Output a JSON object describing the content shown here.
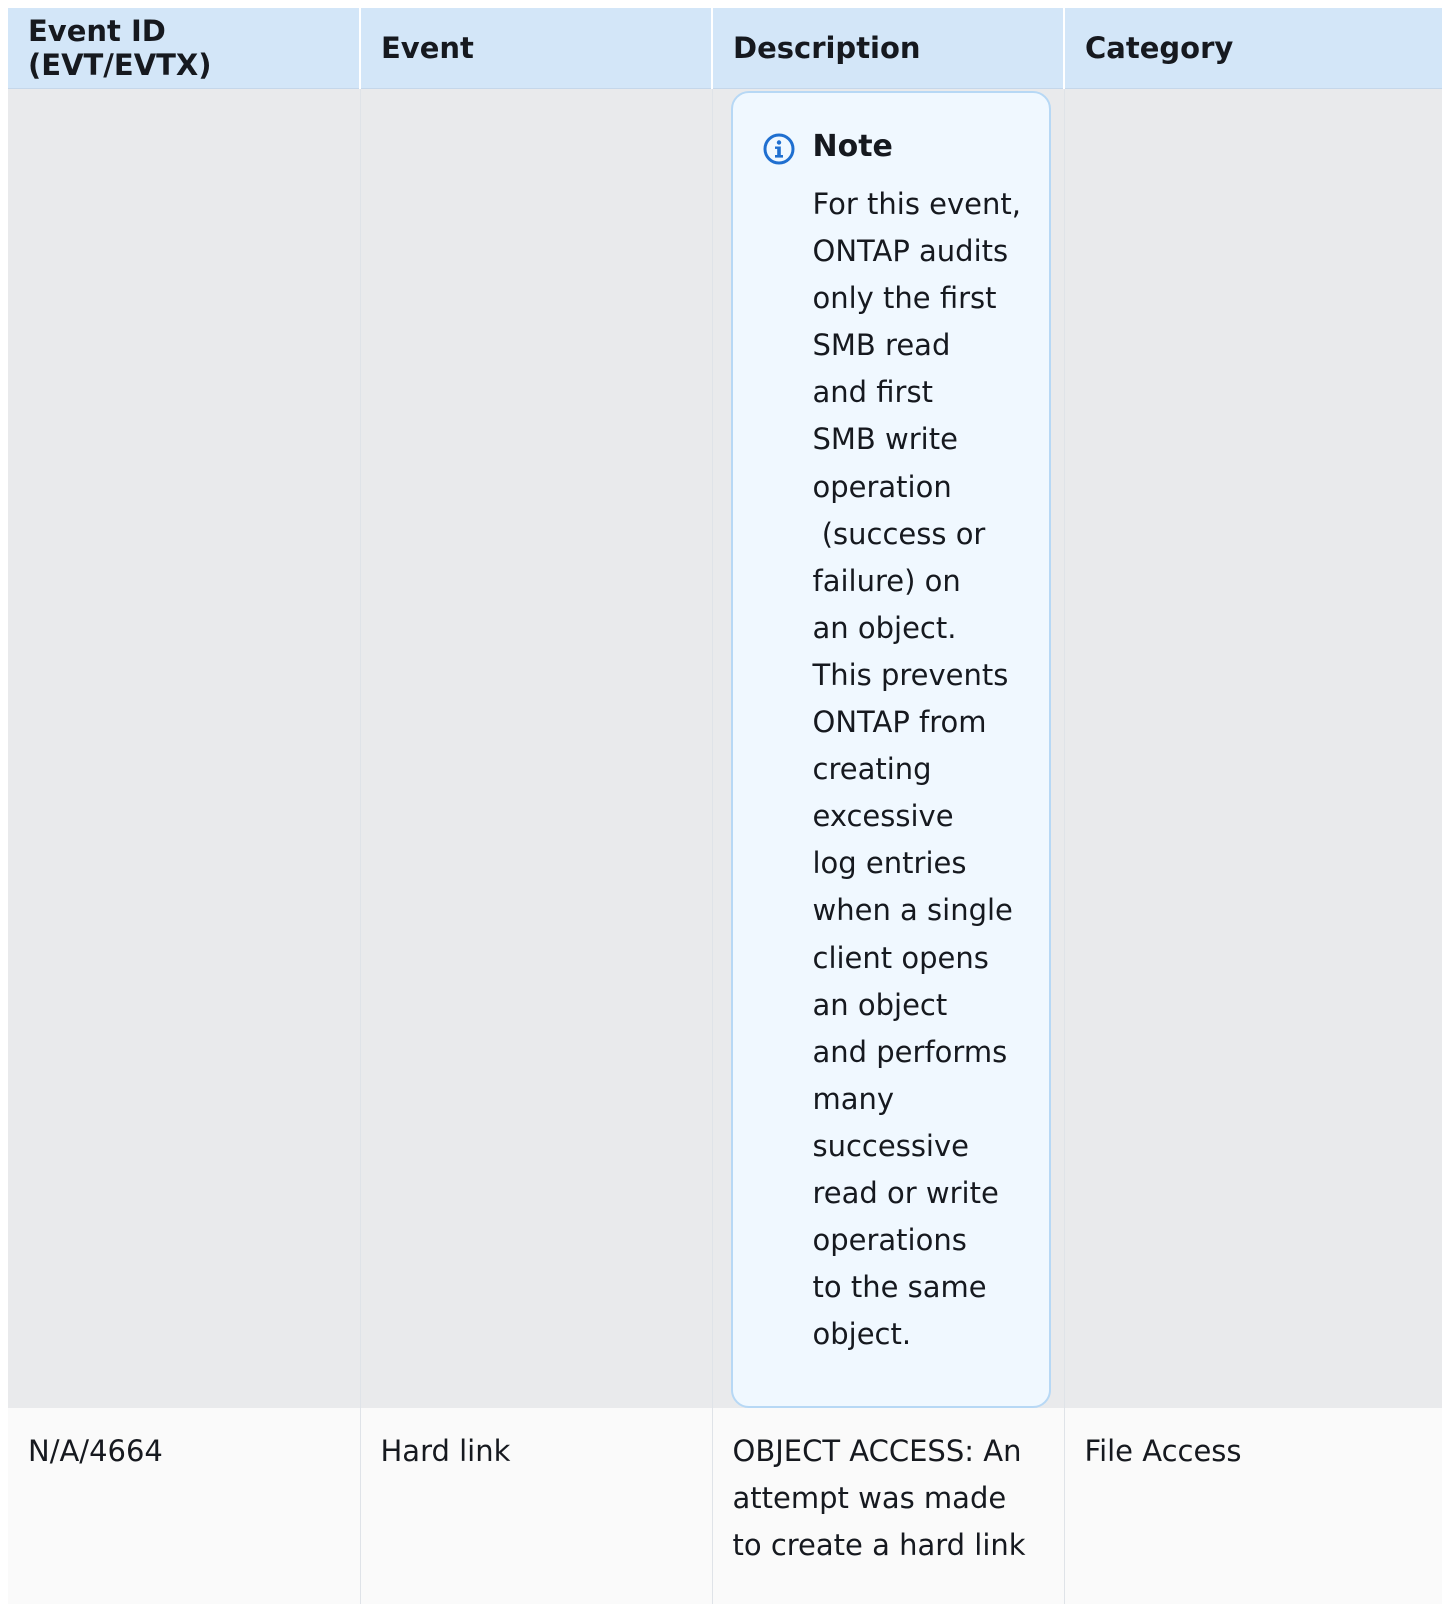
{
  "table": {
    "headers": [
      "Event ID (EVT/EVTX)",
      "Event",
      "Description",
      "Category"
    ],
    "note": {
      "icon": "info-icon",
      "title": "Note",
      "lines": [
        "For this event,",
        "ONTAP audits",
        "only the first",
        "SMB read",
        "and first",
        "SMB write",
        "operation",
        " (success or",
        "failure) on",
        "an object.",
        "This prevents",
        "ONTAP from",
        "creating",
        "excessive",
        "log entries",
        "when a single",
        "client opens",
        "an object",
        "and performs",
        "many",
        "successive",
        "read or write",
        "operations",
        "to the same",
        "object."
      ]
    },
    "rows": [
      {
        "event_id": "N/A/4664",
        "event": "Hard link",
        "description": "OBJECT ACCESS: An attempt was made to create a hard link",
        "category": "File Access"
      }
    ]
  },
  "colors": {
    "header_bg": "#d3e6f8",
    "note_bg": "#f0f8ff",
    "note_border": "#b7d8f5",
    "info_icon": "#1f6fd0"
  }
}
